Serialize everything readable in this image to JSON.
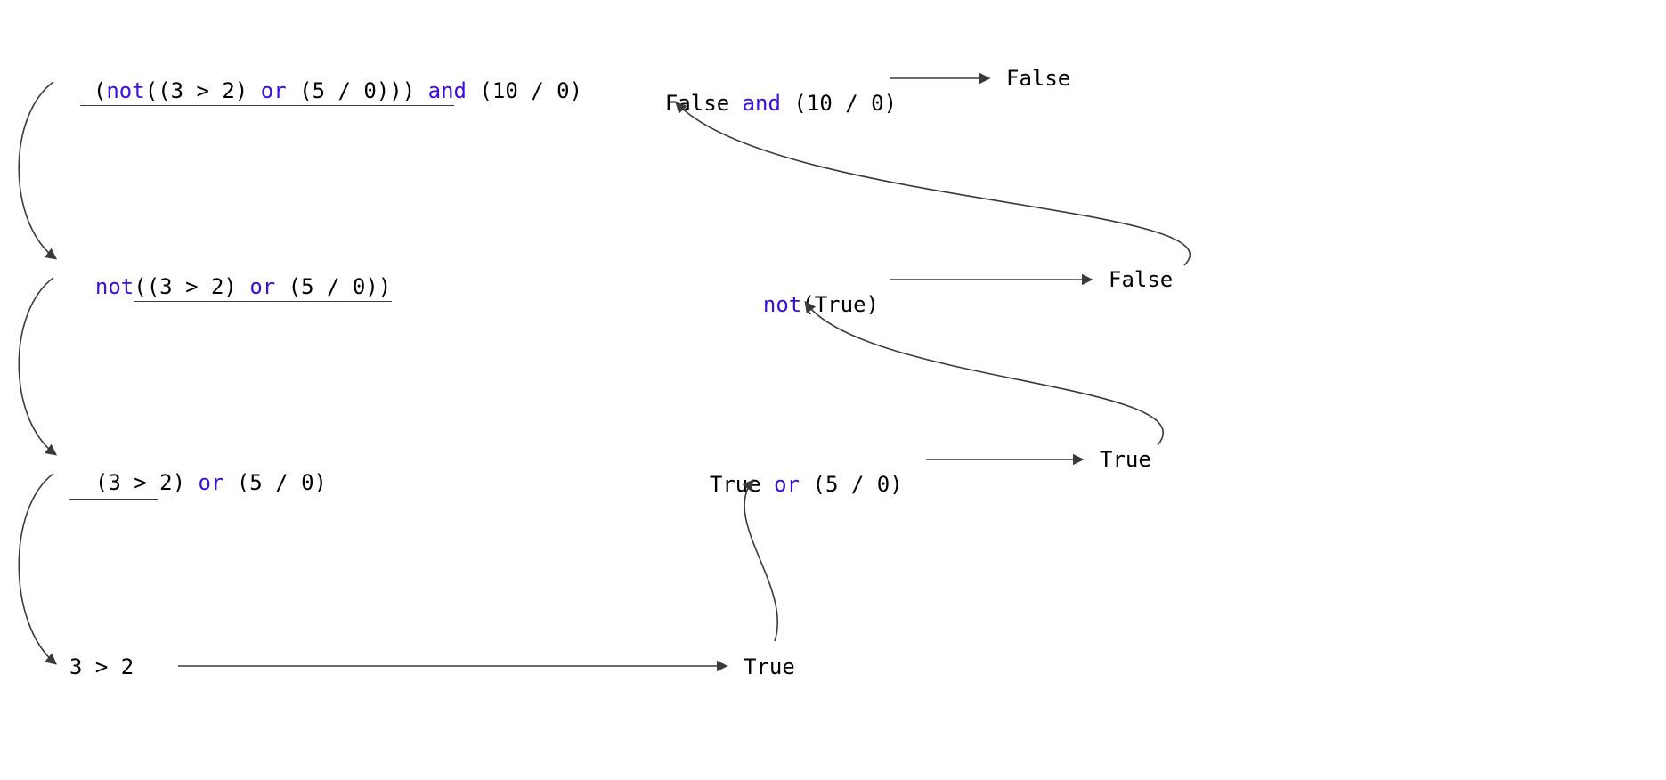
{
  "colors": {
    "keyword": "#3a0ee0",
    "text": "#000000",
    "arrow": "#3a3a3a"
  },
  "steps": {
    "s1": {
      "tokens": {
        "t0": "(",
        "t1": "not",
        "t2": "((3 > 2) ",
        "t3": "or",
        "t4": " (5 / 0))) ",
        "t5": "and",
        "t6": " (10 / 0)"
      }
    },
    "s2": {
      "tokens": {
        "t0": "not",
        "t1": "((3 > 2) ",
        "t2": "or",
        "t3": " (5 / 0))"
      }
    },
    "s3": {
      "tokens": {
        "t0": "(3 > 2) ",
        "t1": "or",
        "t2": " (5 / 0)"
      }
    },
    "s4": {
      "text": "3 > 2"
    },
    "r1": {
      "text": "True"
    },
    "r2": {
      "tokens": {
        "t0": "True ",
        "t1": "or",
        "t2": " (5 / 0)"
      }
    },
    "r2out": {
      "text": "True"
    },
    "r3": {
      "tokens": {
        "t0": "not",
        "t1": "(True)"
      }
    },
    "r3out": {
      "text": "False"
    },
    "r4": {
      "tokens": {
        "t0": "False ",
        "t1": "and",
        "t2": " (10 / 0)"
      }
    },
    "r4out": {
      "text": "False"
    }
  }
}
